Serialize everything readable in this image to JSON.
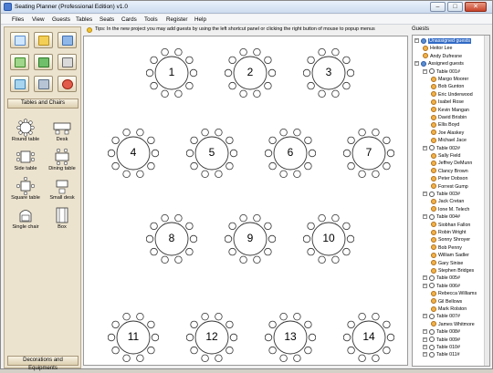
{
  "window": {
    "title": "Seating Planner (Professional Edition) v1.0",
    "minimize": "–",
    "maximize": "□",
    "close": "✕"
  },
  "menu": [
    "Files",
    "View",
    "Guests",
    "Tables",
    "Seats",
    "Cards",
    "Tools",
    "Register",
    "Help"
  ],
  "toolbar_icons": [
    "new-project-icon",
    "open-folder-icon",
    "save-icon",
    "add-guest-icon",
    "excel-icon",
    "print-icon",
    "chart-icon",
    "settings-icon",
    "power-icon"
  ],
  "tables_chairs": {
    "header": "Tables and Chairs",
    "items": [
      {
        "label": "Round table",
        "icon": "round-table-icon"
      },
      {
        "label": "Desk",
        "icon": "desk-icon"
      },
      {
        "label": "Side table",
        "icon": "side-table-icon"
      },
      {
        "label": "Dining table",
        "icon": "dining-table-icon"
      },
      {
        "label": "Square table",
        "icon": "square-table-icon"
      },
      {
        "label": "Small desk",
        "icon": "small-desk-icon"
      },
      {
        "label": "Single chair",
        "icon": "chair-icon"
      },
      {
        "label": "Box",
        "icon": "box-icon"
      }
    ]
  },
  "decorations": {
    "header": "Decorations and Equipments"
  },
  "tip": "Tips: In the new project you may add guests by using the left shortcut panel or clicking the right button of mouse to popup menus",
  "tables": [
    "1",
    "2",
    "3",
    "4",
    "5",
    "6",
    "7",
    "8",
    "9",
    "10",
    "11",
    "12",
    "13",
    "14"
  ],
  "guests": {
    "header": "Guests",
    "tree": [
      {
        "label": "Unassigned guests",
        "level": 0,
        "kind": "group",
        "selected": true
      },
      {
        "label": "Heitor Lee",
        "level": 1,
        "kind": "guest"
      },
      {
        "label": "Andy Dufresne",
        "level": 1,
        "kind": "guest"
      },
      {
        "label": "Assigned guests",
        "level": 0,
        "kind": "group"
      },
      {
        "label": "Table 001#",
        "level": 1,
        "kind": "table"
      },
      {
        "label": "Margo Moorer",
        "level": 2,
        "kind": "guest"
      },
      {
        "label": "Bob Gunton",
        "level": 2,
        "kind": "guest"
      },
      {
        "label": "Eric Underwood",
        "level": 2,
        "kind": "guest"
      },
      {
        "label": "Isabel Rose",
        "level": 2,
        "kind": "guest"
      },
      {
        "label": "Kevin Mangan",
        "level": 2,
        "kind": "guest"
      },
      {
        "label": "David Brisbin",
        "level": 2,
        "kind": "guest"
      },
      {
        "label": "Ellis Boyd",
        "level": 2,
        "kind": "guest"
      },
      {
        "label": "Joe Alaskey",
        "level": 2,
        "kind": "guest"
      },
      {
        "label": "Michael Jace",
        "level": 2,
        "kind": "guest"
      },
      {
        "label": "Table 002#",
        "level": 1,
        "kind": "table"
      },
      {
        "label": "Sally Field",
        "level": 2,
        "kind": "guest"
      },
      {
        "label": "Jeffrey DeMunn",
        "level": 2,
        "kind": "guest"
      },
      {
        "label": "Clancy Brown",
        "level": 2,
        "kind": "guest"
      },
      {
        "label": "Peter Dobson",
        "level": 2,
        "kind": "guest"
      },
      {
        "label": "Forrest Gump",
        "level": 2,
        "kind": "guest"
      },
      {
        "label": "Table 003#",
        "level": 1,
        "kind": "table"
      },
      {
        "label": "Jack Cretan",
        "level": 2,
        "kind": "guest"
      },
      {
        "label": "Ione M. Telech",
        "level": 2,
        "kind": "guest"
      },
      {
        "label": "Table 004#",
        "level": 1,
        "kind": "table"
      },
      {
        "label": "Siobhan Fallon",
        "level": 2,
        "kind": "guest"
      },
      {
        "label": "Robin Wright",
        "level": 2,
        "kind": "guest"
      },
      {
        "label": "Sonny Shroyer",
        "level": 2,
        "kind": "guest"
      },
      {
        "label": "Bob Penny",
        "level": 2,
        "kind": "guest"
      },
      {
        "label": "William Sadler",
        "level": 2,
        "kind": "guest"
      },
      {
        "label": "Gary Sinise",
        "level": 2,
        "kind": "guest"
      },
      {
        "label": "Stephen Bridges",
        "level": 2,
        "kind": "guest"
      },
      {
        "label": "Table 005#",
        "level": 1,
        "kind": "table"
      },
      {
        "label": "Table 006#",
        "level": 1,
        "kind": "table"
      },
      {
        "label": "Rebecca Williams",
        "level": 2,
        "kind": "guest"
      },
      {
        "label": "Gil Bellows",
        "level": 2,
        "kind": "guest"
      },
      {
        "label": "Mark Rolston",
        "level": 2,
        "kind": "guest"
      },
      {
        "label": "Table 007#",
        "level": 1,
        "kind": "table"
      },
      {
        "label": "James Whitmore",
        "level": 2,
        "kind": "guest"
      },
      {
        "label": "Table 008#",
        "level": 1,
        "kind": "table"
      },
      {
        "label": "Table 009#",
        "level": 1,
        "kind": "table"
      },
      {
        "label": "Table 010#",
        "level": 1,
        "kind": "table"
      },
      {
        "label": "Table 011#",
        "level": 1,
        "kind": "table"
      }
    ]
  },
  "colors": {
    "accent": "#316ac5",
    "panel": "#ece3cf",
    "canvas": "#ffffff"
  }
}
